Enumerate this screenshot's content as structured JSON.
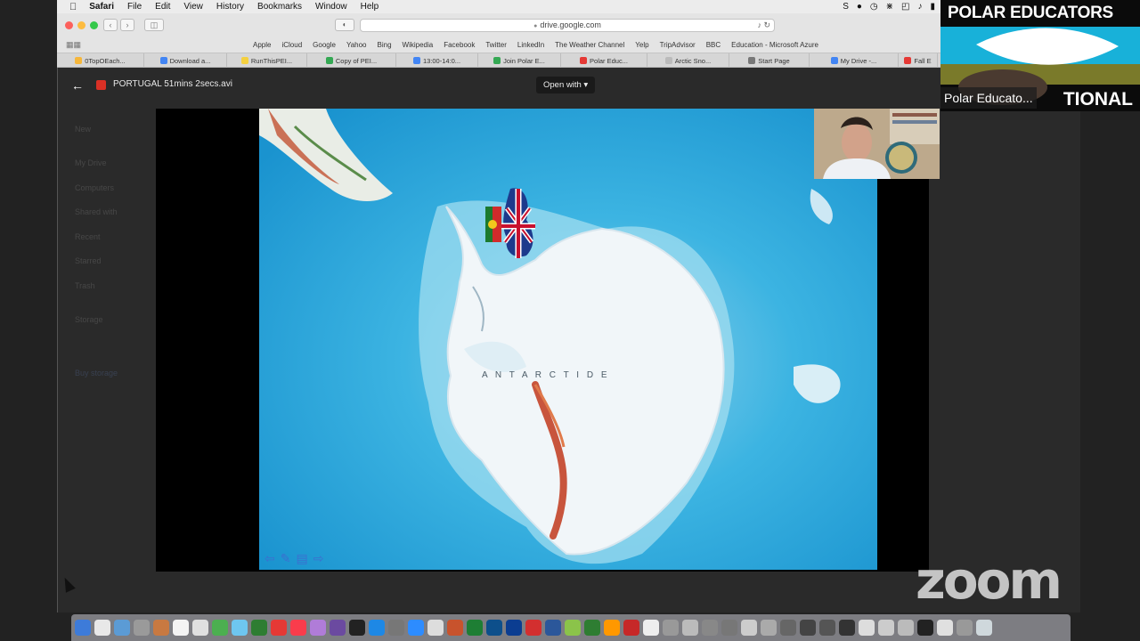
{
  "menubar": {
    "app": "Safari",
    "items": [
      "File",
      "Edit",
      "View",
      "History",
      "Bookmarks",
      "Window",
      "Help"
    ]
  },
  "safari": {
    "url": "drive.google.com",
    "favorites": [
      "Apple",
      "iCloud",
      "Google",
      "Yahoo",
      "Bing",
      "Wikipedia",
      "Facebook",
      "Twitter",
      "LinkedIn",
      "The Weather Channel",
      "Yelp",
      "TripAdvisor",
      "BBC",
      "Education - Microsoft Azure"
    ],
    "tabs": [
      {
        "label": "0TopOEach...",
        "color": "#f6b73c"
      },
      {
        "label": "Download a...",
        "color": "#4285f4"
      },
      {
        "label": "RunThisPEI...",
        "color": "#f4d03f"
      },
      {
        "label": "Copy of PEI...",
        "color": "#34a853"
      },
      {
        "label": "13:00-14:0...",
        "color": "#4285f4"
      },
      {
        "label": "Join Polar E...",
        "color": "#34a853"
      },
      {
        "label": "Polar Educ...",
        "color": "#e53935"
      },
      {
        "label": "Arctic Sno...",
        "color": "#bbbbbb"
      },
      {
        "label": "Start Page",
        "color": "#777777"
      },
      {
        "label": "My Drive -...",
        "color": "#4285f4"
      },
      {
        "label": "Fall E",
        "color": "#e53935"
      }
    ]
  },
  "viewer": {
    "file_name": "PORTUGAL 51mins 2secs.avi",
    "open_with": "Open with"
  },
  "drive_ghost": [
    "New",
    "My Drive",
    "Computers",
    "Shared with",
    "Recent",
    "Starred",
    "Trash",
    "Storage",
    "Buy storage"
  ],
  "map": {
    "continent_label": "A N T A R C T I D E"
  },
  "banner": {
    "title": "POLAR EDUCATORS",
    "sub": "TIONAL",
    "participant": "Polar Educato..."
  },
  "zoom_watermark": "zoom",
  "colors": {
    "ocean": "#1fa3d6",
    "ice": "#f1f6f9",
    "mountains": "#c8553d"
  }
}
